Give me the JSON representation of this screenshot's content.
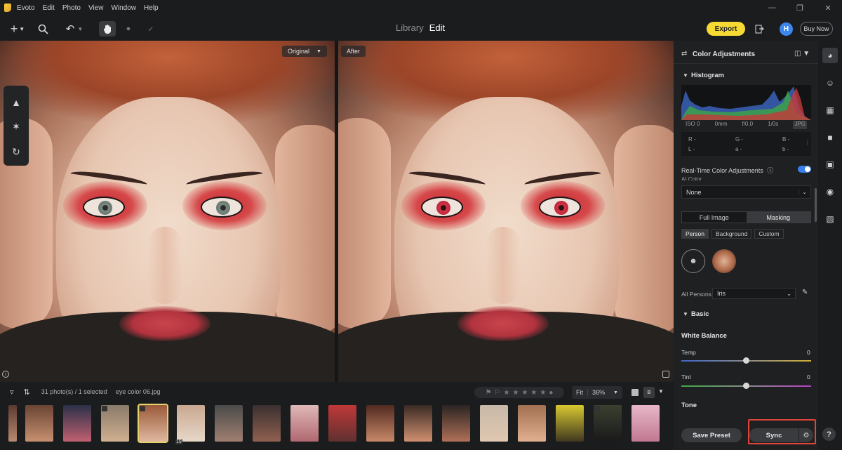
{
  "menu": [
    "Evoto",
    "Edit",
    "Photo",
    "View",
    "Window",
    "Help"
  ],
  "modes": {
    "library": "Library",
    "edit": "Edit"
  },
  "toolbar": {
    "export": "Export",
    "avatar": "H",
    "buy": "Buy Now"
  },
  "canvas": {
    "original_label": "Original",
    "after_label": "After"
  },
  "filmstrip": {
    "count_text": "31 photo(s) / 1 selected",
    "filename": "eye color 06.jpg",
    "zoom_fit": "Fit",
    "zoom_level": "36%",
    "badge_19": "19"
  },
  "panel": {
    "title": "Color Adjustments",
    "histogram": "Histogram",
    "meta": {
      "iso": "ISO 0",
      "mm": "0mm",
      "f": "f/0.0",
      "shutter": "1/0s",
      "fmt": "JPG"
    },
    "rgb": {
      "r": "R -",
      "g": "G -",
      "b": "B -",
      "l": "L -",
      "a": "a -",
      "bb": "b -"
    },
    "realtime": "Real-Time Color Adjustments",
    "ai_color": "AI Color",
    "ai_value": "None",
    "seg_full": "Full Image",
    "seg_mask": "Masking",
    "chip_person": "Person",
    "chip_bg": "Background",
    "chip_custom": "Custom",
    "all_persons": "All Persons",
    "person_value": "Iris",
    "basic": "Basic",
    "white_balance": "White Balance",
    "temp": "Temp",
    "temp_value": "0",
    "tint": "Tint",
    "tint_value": "0",
    "temp_level": 0.5,
    "tint_level": 0.5,
    "tone": "Tone",
    "save_preset": "Save Preset",
    "sync": "Sync"
  },
  "help": "?",
  "colors": {
    "accent": "#f7d934",
    "toggle": "#3a7ff0",
    "highlight": "#e0443a"
  }
}
